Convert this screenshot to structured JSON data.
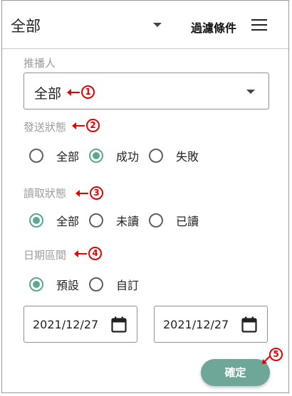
{
  "header": {
    "selected": "全部",
    "filter_label": "過濾條件"
  },
  "pusher": {
    "label": "推播人",
    "value": "全部"
  },
  "send_status": {
    "label": "發送狀態",
    "options": [
      "全部",
      "成功",
      "失敗"
    ],
    "selected": "成功"
  },
  "read_status": {
    "label": "讀取狀態",
    "options": [
      "全部",
      "未讀",
      "已讀"
    ],
    "selected": "全部"
  },
  "date_range": {
    "label": "日期區間",
    "options": [
      "預設",
      "自訂"
    ],
    "selected": "預設",
    "start": "2021/12/27",
    "end": "2021/12/27"
  },
  "confirm_label": "確定",
  "markers": [
    "1",
    "2",
    "3",
    "4",
    "5"
  ],
  "colors": {
    "accent": "#5aa892",
    "button": "#6fa69a",
    "annotation": "#e60000"
  }
}
